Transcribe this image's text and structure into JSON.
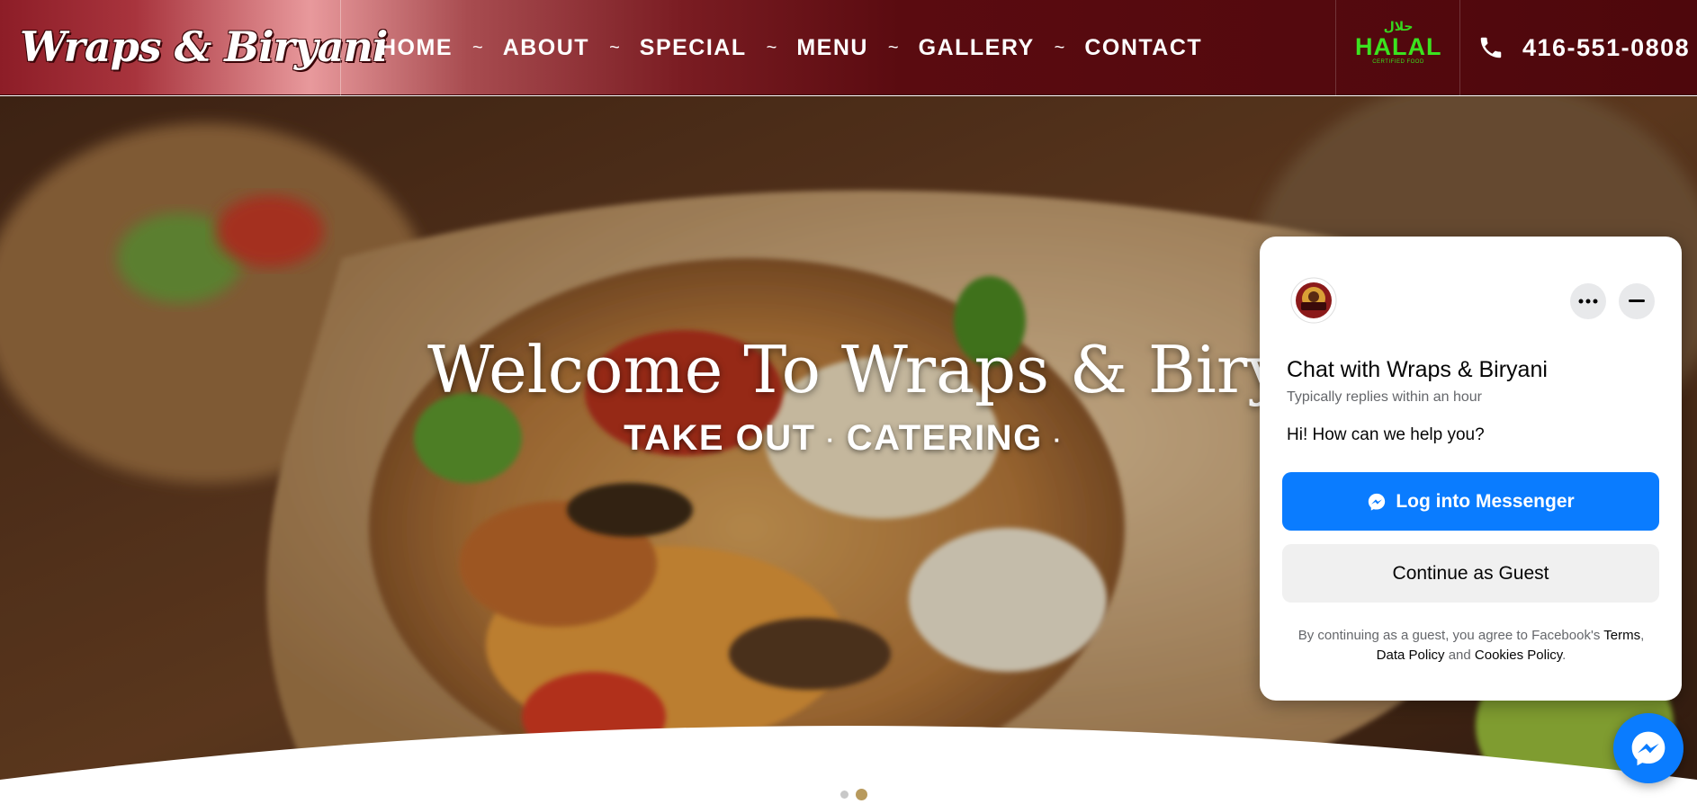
{
  "header": {
    "logo_text": "Wraps & Biryani",
    "nav": [
      {
        "label": "HOME"
      },
      {
        "label": "ABOUT"
      },
      {
        "label": "SPECIAL"
      },
      {
        "label": "MENU"
      },
      {
        "label": "GALLERY"
      },
      {
        "label": "CONTACT"
      }
    ],
    "nav_separator": "~",
    "halal": {
      "arabic": "حلال",
      "word": "HALAL",
      "sub": "CERTIFIED FOOD"
    },
    "phone": "416-551-0808",
    "colors": {
      "header_dark": "#4e070c",
      "header_light": "#e8999c",
      "halal_green": "#3be21f"
    }
  },
  "hero": {
    "title": "Welcome To Wraps & Biryani",
    "subtitle_parts": [
      "TAKE OUT",
      "CATERING"
    ],
    "subtitle_dot": "·",
    "slider": {
      "count": 2,
      "active_index": 2
    }
  },
  "chat": {
    "title": "Chat with Wraps & Biryani",
    "reply_time": "Typically replies within an hour",
    "greeting": "Hi! How can we help you?",
    "login_label": "Log into Messenger",
    "guest_label": "Continue as Guest",
    "legal_prefix": "By continuing as a guest, you agree to Facebook's",
    "terms_label": "Terms",
    "data_policy_label": "Data Policy",
    "and_text": "and",
    "cookies_label": "Cookies Policy",
    "icons": {
      "more": "more-icon",
      "minimize": "minimize-icon",
      "messenger": "messenger-icon"
    },
    "colors": {
      "messenger_blue": "#0a7cff"
    }
  }
}
